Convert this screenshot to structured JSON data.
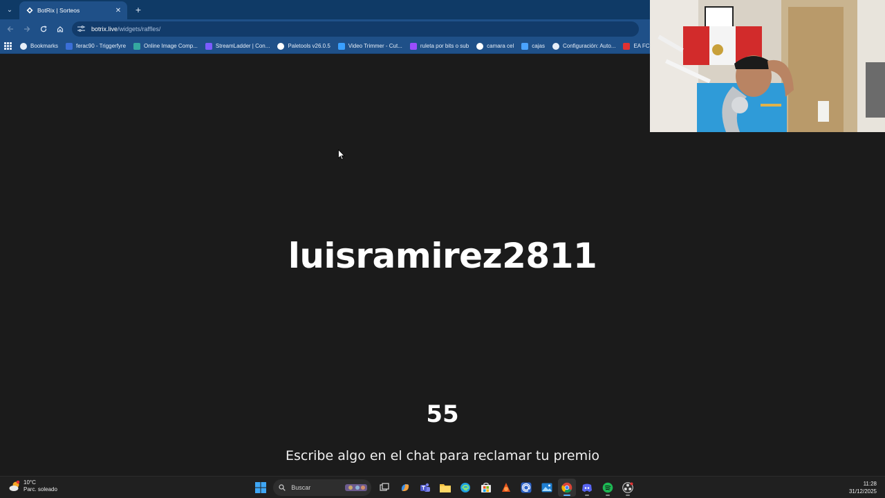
{
  "browser": {
    "tab": {
      "title": "BotRix | Sorteos"
    },
    "address": {
      "host": "botrix.live",
      "path": "/widgets/raffles/"
    },
    "bookmarks": [
      {
        "label": "Bookmarks",
        "icon": "star-icon",
        "color": "#e6eef8"
      },
      {
        "label": "ferac90 - Triggerfyre",
        "icon": "triggerfyre-icon",
        "color": "#3b6fd8"
      },
      {
        "label": "Online Image Comp...",
        "icon": "image-compress-icon",
        "color": "#35a8a0"
      },
      {
        "label": "StreamLadder | Con...",
        "icon": "streamladder-icon",
        "color": "#7b5cff"
      },
      {
        "label": "Paletools v26.0.5",
        "icon": "paletools-icon",
        "color": "#ffffff"
      },
      {
        "label": "Video Trimmer - Cut...",
        "icon": "video-trimmer-icon",
        "color": "#3aa0ff"
      },
      {
        "label": "ruleta por bits o sub",
        "icon": "ruleta-icon",
        "color": "#9b4dff"
      },
      {
        "label": "camara cel",
        "icon": "camara-icon",
        "color": "#ffffff"
      },
      {
        "label": "cajas",
        "icon": "cajas-icon",
        "color": "#4aa3ff"
      },
      {
        "label": "Configuración: Auto...",
        "icon": "gear-icon",
        "color": "#e6eef8"
      },
      {
        "label": "EA FC 2",
        "icon": "ea-icon",
        "color": "#e03131"
      }
    ]
  },
  "raffle": {
    "winner": "luisramirez2811",
    "countdown": "55",
    "message": "Escribe algo en el chat para reclamar tu premio"
  },
  "taskbar": {
    "weather": {
      "temp": "10°C",
      "condition": "Parc. soleado"
    },
    "search_placeholder": "Buscar",
    "clock": {
      "time": "11:28",
      "date": "31/12/2025"
    }
  }
}
